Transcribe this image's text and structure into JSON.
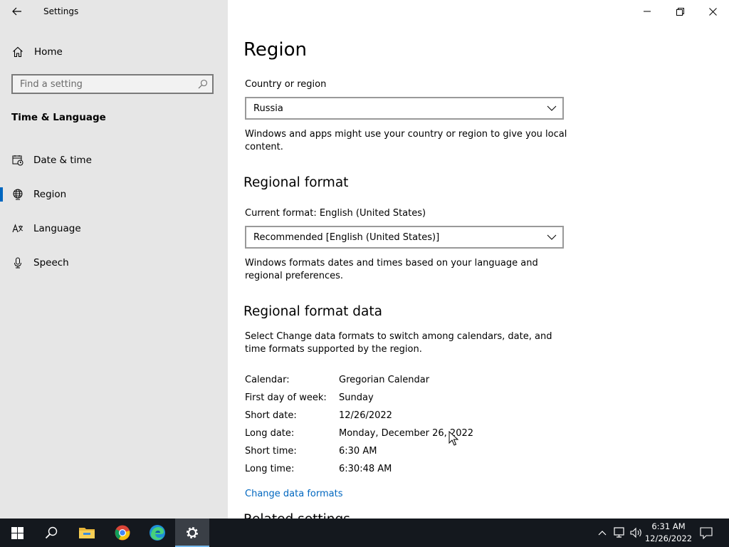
{
  "window": {
    "title": "Settings"
  },
  "sidebar": {
    "home_label": "Home",
    "search_placeholder": "Find a setting",
    "section_title": "Time & Language",
    "items": [
      {
        "label": "Date & time",
        "icon": "calendar-clock-icon"
      },
      {
        "label": "Region",
        "icon": "globe-icon",
        "active": true
      },
      {
        "label": "Language",
        "icon": "language-icon"
      },
      {
        "label": "Speech",
        "icon": "microphone-icon"
      }
    ]
  },
  "main": {
    "title": "Region",
    "country_label": "Country or region",
    "country_value": "Russia",
    "country_desc": "Windows and apps might use your country or region to give you local content.",
    "regional_format_heading": "Regional format",
    "current_format_label": "Current format: English (United States)",
    "format_value": "Recommended [English (United States)]",
    "format_desc": "Windows formats dates and times based on your language and regional preferences.",
    "format_data_heading": "Regional format data",
    "format_data_desc": "Select Change data formats to switch among calendars, date, and time formats supported by the region.",
    "format_data": [
      {
        "key": "Calendar:",
        "value": "Gregorian Calendar"
      },
      {
        "key": "First day of week:",
        "value": "Sunday"
      },
      {
        "key": "Short date:",
        "value": "12/26/2022"
      },
      {
        "key": "Long date:",
        "value": "Monday, December 26, 2022"
      },
      {
        "key": "Short time:",
        "value": "6:30 AM"
      },
      {
        "key": "Long time:",
        "value": "6:30:48 AM"
      }
    ],
    "change_link": "Change data formats",
    "related_heading": "Related settings"
  },
  "taskbar": {
    "apps": [
      "start-icon",
      "search-icon",
      "file-explorer-icon",
      "chrome-icon",
      "edge-icon",
      "settings-icon"
    ],
    "active_app": "settings-icon",
    "time": "6:31 AM",
    "date": "12/26/2022"
  },
  "colors": {
    "accent": "#0067c0",
    "sidebar_bg": "#e6e6e6",
    "taskbar_bg": "#14181e"
  }
}
